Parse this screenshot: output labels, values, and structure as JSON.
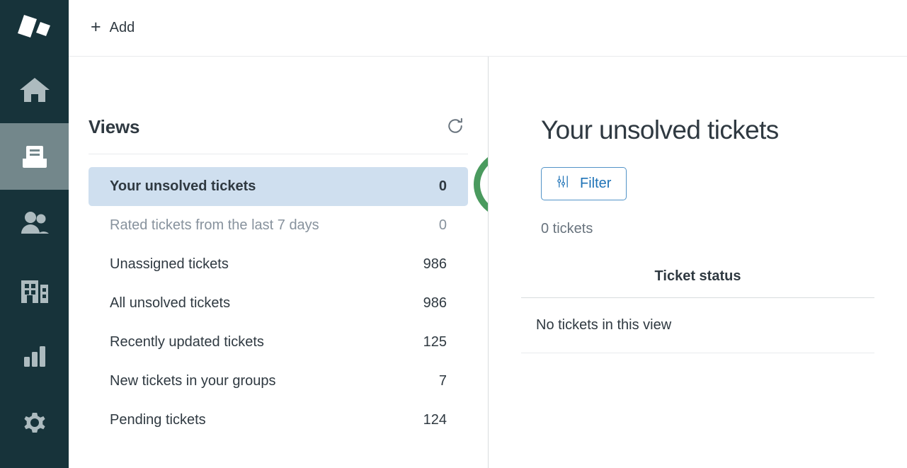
{
  "brand": {
    "logo_icon": "zendesk-logo-icon",
    "rail_bg": "#17333a",
    "rail_active_bg": "#73878b",
    "rail_icon_color": "#adbbbf",
    "accent_blue": "#1f73b7",
    "selected_row_bg": "#cfdfef",
    "annotation_color": "#4a9a5e"
  },
  "sidebar": {
    "items": [
      {
        "name": "home",
        "icon": "home-icon",
        "active": false
      },
      {
        "name": "views",
        "icon": "views-inbox-icon",
        "active": true
      },
      {
        "name": "customers",
        "icon": "people-icon",
        "active": false
      },
      {
        "name": "organizations",
        "icon": "buildings-icon",
        "active": false
      },
      {
        "name": "reporting",
        "icon": "bar-chart-icon",
        "active": false
      },
      {
        "name": "admin",
        "icon": "gear-icon",
        "active": false
      }
    ]
  },
  "topbar": {
    "add_label": "Add",
    "add_icon": "plus-icon"
  },
  "views_panel": {
    "title": "Views",
    "refresh_icon": "refresh-icon",
    "items": [
      {
        "label": "Your unsolved tickets",
        "count": "0",
        "state": "selected"
      },
      {
        "label": "Rated tickets from the last 7 days",
        "count": "0",
        "state": "muted"
      },
      {
        "label": "Unassigned tickets",
        "count": "986",
        "state": "normal"
      },
      {
        "label": "All unsolved tickets",
        "count": "986",
        "state": "normal"
      },
      {
        "label": "Recently updated tickets",
        "count": "125",
        "state": "normal"
      },
      {
        "label": "New tickets in your groups",
        "count": "7",
        "state": "normal"
      },
      {
        "label": "Pending tickets",
        "count": "124",
        "state": "normal"
      }
    ]
  },
  "detail_panel": {
    "title": "Your unsolved tickets",
    "filter_label": "Filter",
    "filter_icon": "sliders-icon",
    "ticket_count_label": "0 tickets",
    "table_header": "Ticket status",
    "empty_message": "No tickets in this view"
  }
}
